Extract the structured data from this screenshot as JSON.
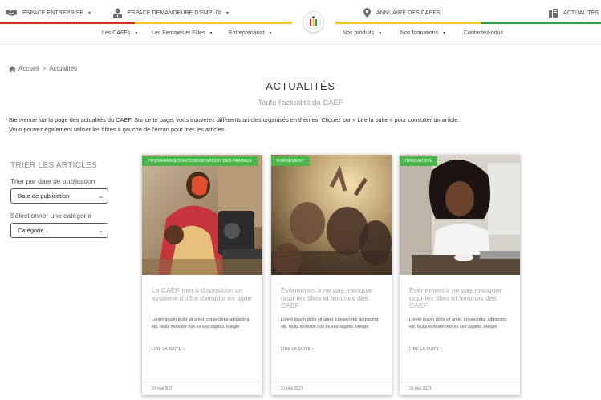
{
  "topbar": {
    "espace_entreprise": "ESPACE ENTREPRISE",
    "espace_demandeur": "ESPACE DEMANDEURE D'EMPLOI",
    "annuaire": "ANNUAIRE DES CAEFS",
    "actualites": "ACTUALITÉS",
    "caret": "▾",
    "colors": {
      "red": "#d9262a",
      "yellow": "#f2c81c",
      "green": "#2e9e48"
    }
  },
  "nav": {
    "items": [
      {
        "label": "Les CAEFs",
        "caret": "▾"
      },
      {
        "label": "Les Femmes et Filles",
        "caret": "▾"
      },
      {
        "label": "Entreprenariat",
        "caret": "▾"
      },
      {
        "label": "Nos produits",
        "caret": "▾"
      },
      {
        "label": "Nos formations",
        "caret": "▾"
      },
      {
        "label": "Contactez-nous",
        "caret": ""
      }
    ]
  },
  "breadcrumb": {
    "home": "Accueil",
    "separator": ">",
    "current": "Actualités"
  },
  "page": {
    "title": "ACTUALITÉS",
    "subtitle": "Toute l'actualité du CAEF",
    "intro_line1": "Bienvenue sur la page des actualités du CAEF. Sur cette page, vous trouverez différents articles organisés en thèmes. Cliquez sur « Lire la suite » pour consulter un article.",
    "intro_line2": "Vous pouvez également utiliser les filtres à gauche de l'écran pour trier les articles."
  },
  "filters": {
    "title": "TRIER LES ARTICLES",
    "date_label": "Trier par date de publication",
    "date_value": "Date de publication",
    "category_label": "Sélectionner une catégorie",
    "category_value": "Catégorie...",
    "arrow": "⌄"
  },
  "cards": [
    {
      "badge": "PROGRAMME D'AUTONOMISATION DES FEMMES",
      "title": "Le CAEF met à disposition un système d'offre d'emploi en ligne",
      "excerpt": "Lorem ipsum dolor sit amet, consectetur adipiscing elit. Nulla molestie non ex sed sagittis. Integer",
      "more": "LIRE LA SUITE »",
      "date": "31 mai 2021",
      "image": "seamstress-photo"
    },
    {
      "badge": "ÉVÉNEMENT",
      "title": "Evènement à ne pas manquer pour les filles et femmes des CAEF",
      "excerpt": "Lorem ipsum dolor sit amet, consectetur adipiscing elit. Nulla molestie non ex sed sagittis. Integer",
      "more": "LIRE LA SUITE »",
      "date": "31 mai 2021",
      "image": "crowd-photo"
    },
    {
      "badge": "INNOVATION",
      "title": "Evènement à ne pas manquer pour les filles et femmes des CAEF",
      "excerpt": "Lorem ipsum dolor sit amet, consectetur adipiscing elit. Nulla molestie non ex sed sagittis. Integer",
      "more": "LIRE LA SUITE »",
      "date": "31 mai 2021",
      "image": "woman-laptop-photo"
    }
  ]
}
